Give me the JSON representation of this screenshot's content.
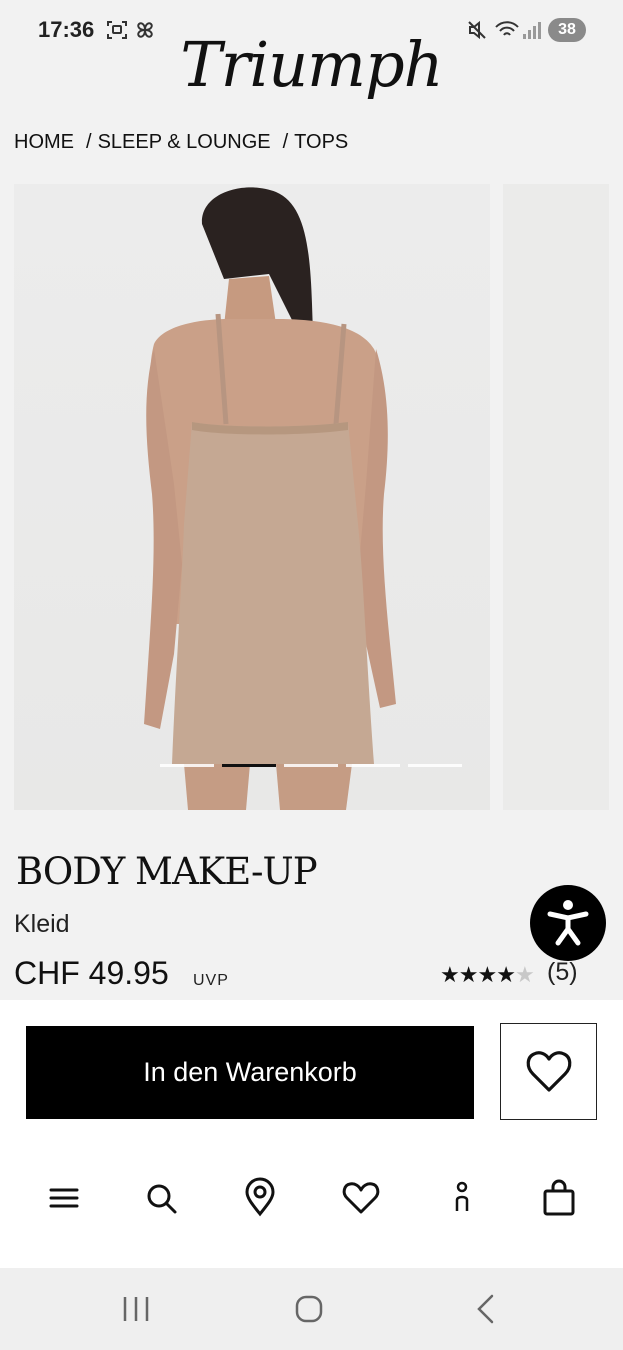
{
  "status_bar": {
    "time": "17:36",
    "battery": "38",
    "icons": [
      "screenshot-icon",
      "pinwheel-icon",
      "mute-icon",
      "wifi-icon",
      "signal-icon"
    ]
  },
  "brand": {
    "logo": "Triumph"
  },
  "breadcrumb": {
    "items": [
      "HOME",
      "SLEEP & LOUNGE",
      "TOPS"
    ],
    "separator": "/"
  },
  "gallery": {
    "slide_count": 5,
    "active_index": 1
  },
  "product": {
    "name": "BODY MAKE-UP",
    "type": "Kleid",
    "price": "CHF 49.95",
    "price_note": "UVP",
    "rating_value": 4.5,
    "rating_max": 5,
    "reviews": "(5)"
  },
  "actions": {
    "add_to_cart": "In den Warenkorb",
    "wishlist_icon": "heart-icon",
    "accessibility_icon": "accessibility-icon"
  },
  "bottom_nav": {
    "items": [
      "menu-icon",
      "search-icon",
      "store-locator-icon",
      "wishlist-icon",
      "account-icon",
      "bag-icon"
    ]
  },
  "system_nav": {
    "items": [
      "recents-icon",
      "home-icon",
      "back-icon"
    ]
  },
  "colors": {
    "accent": "#000000",
    "background": "#f2f2f2",
    "product_beige": "#c5a893"
  }
}
